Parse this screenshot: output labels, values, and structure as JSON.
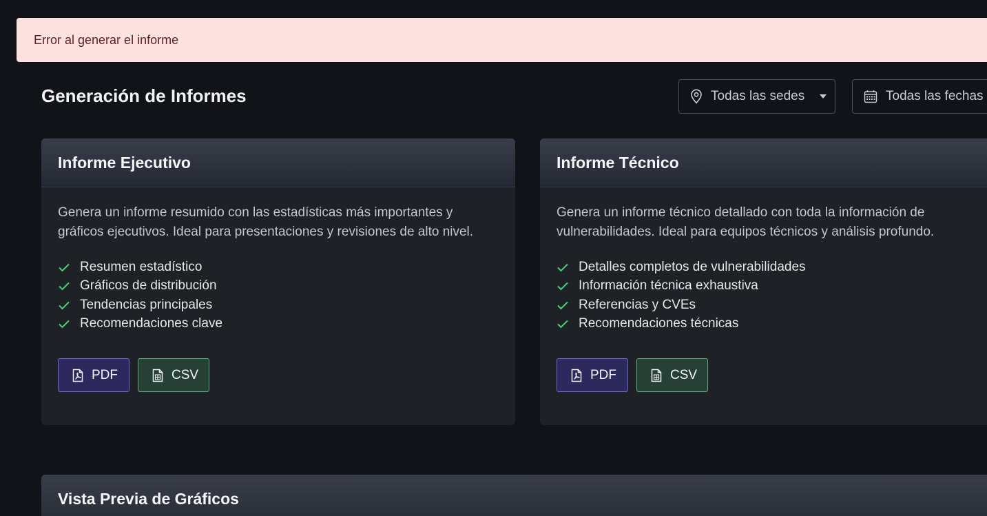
{
  "alert": {
    "message": "Error al generar el informe"
  },
  "header": {
    "title": "Generación de Informes",
    "location_filter": "Todas las sedes",
    "date_filter": "Todas las fechas"
  },
  "cards": [
    {
      "title": "Informe Ejecutivo",
      "description": "Genera un informe resumido con las estadísticas más importantes y gráficos ejecutivos. Ideal para presentaciones y revisiones de alto nivel.",
      "features": [
        "Resumen estadístico",
        "Gráficos de distribución",
        "Tendencias principales",
        "Recomendaciones clave"
      ],
      "pdf_label": "PDF",
      "csv_label": "CSV"
    },
    {
      "title": "Informe Técnico",
      "description": "Genera un informe técnico detallado con toda la información de vulnerabilidades. Ideal para equipos técnicos y análisis profundo.",
      "features": [
        "Detalles completos de vulnerabilidades",
        "Información técnica exhaustiva",
        "Referencias y CVEs",
        "Recomendaciones técnicas"
      ],
      "pdf_label": "PDF",
      "csv_label": "CSV"
    }
  ],
  "preview": {
    "title": "Vista Previa de Gráficos"
  },
  "colors": {
    "alert_bg": "#fde1e1",
    "check": "#4ccf7a",
    "pdf_border": "#6f66d6",
    "csv_border": "#55b07a"
  },
  "icons": [
    "map-pin-icon",
    "chevron-down-icon",
    "calendar-icon",
    "check-icon",
    "file-pdf-icon",
    "file-spreadsheet-icon"
  ]
}
